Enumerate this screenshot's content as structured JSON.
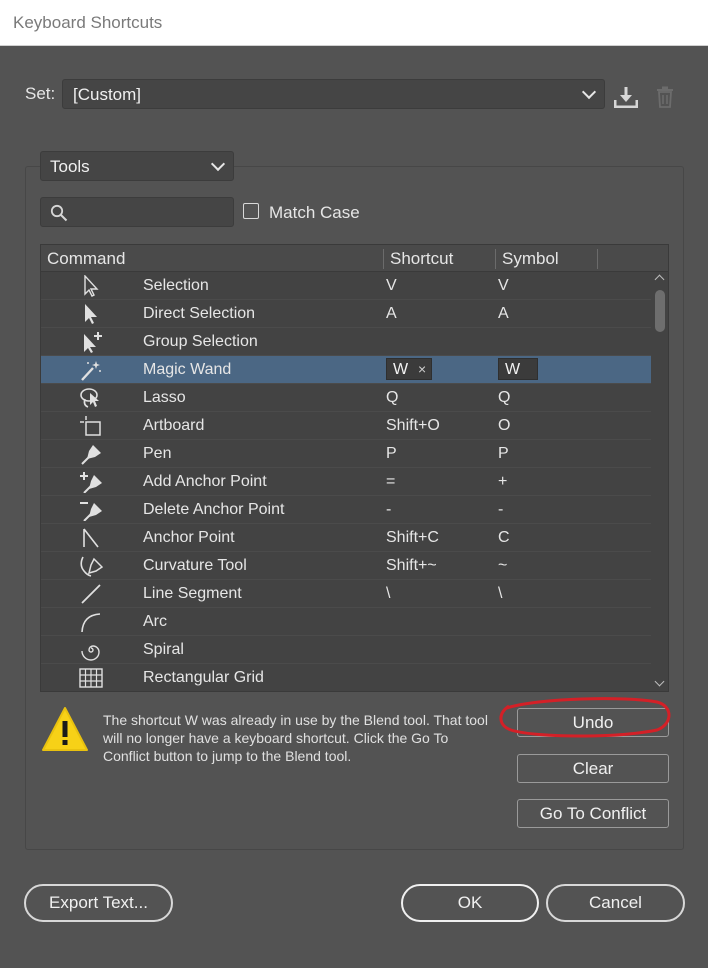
{
  "window": {
    "title": "Keyboard Shortcuts"
  },
  "set": {
    "label": "Set:",
    "value": "[Custom]"
  },
  "category": {
    "value": "Tools"
  },
  "search": {
    "placeholder": "",
    "value": ""
  },
  "match_case": {
    "label": "Match Case",
    "checked": false
  },
  "table": {
    "headers": {
      "command": "Command",
      "shortcut": "Shortcut",
      "symbol": "Symbol"
    },
    "rows": [
      {
        "icon": "selection-arrow-icon",
        "command": "Selection",
        "shortcut": "V",
        "symbol": "V"
      },
      {
        "icon": "direct-selection-arrow-icon",
        "command": "Direct Selection",
        "shortcut": "A",
        "symbol": "A"
      },
      {
        "icon": "group-selection-icon",
        "command": "Group Selection",
        "shortcut": "",
        "symbol": ""
      },
      {
        "icon": "magic-wand-icon",
        "command": "Magic Wand",
        "shortcut": "W",
        "symbol": "W",
        "selected": true
      },
      {
        "icon": "lasso-icon",
        "command": "Lasso",
        "shortcut": "Q",
        "symbol": "Q"
      },
      {
        "icon": "artboard-icon",
        "command": "Artboard",
        "shortcut": "Shift+O",
        "symbol": "O"
      },
      {
        "icon": "pen-icon",
        "command": "Pen",
        "shortcut": "P",
        "symbol": "P"
      },
      {
        "icon": "add-anchor-point-icon",
        "command": "Add Anchor Point",
        "shortcut": "=",
        "symbol": "+"
      },
      {
        "icon": "delete-anchor-point-icon",
        "command": "Delete Anchor Point",
        "shortcut": "-",
        "symbol": "-"
      },
      {
        "icon": "anchor-point-icon",
        "command": "Anchor Point",
        "shortcut": "Shift+C",
        "symbol": "C"
      },
      {
        "icon": "curvature-tool-icon",
        "command": "Curvature Tool",
        "shortcut": "Shift+~",
        "symbol": "~"
      },
      {
        "icon": "line-segment-icon",
        "command": "Line Segment",
        "shortcut": "\\",
        "symbol": "\\"
      },
      {
        "icon": "arc-icon",
        "command": "Arc",
        "shortcut": "",
        "symbol": ""
      },
      {
        "icon": "spiral-icon",
        "command": "Spiral",
        "shortcut": "",
        "symbol": ""
      },
      {
        "icon": "rectangular-grid-icon",
        "command": "Rectangular Grid",
        "shortcut": "",
        "symbol": ""
      }
    ]
  },
  "conflict": {
    "icon": "warning-icon",
    "message": "The shortcut W was already in use by the Blend tool. That tool will no longer have a keyboard shortcut. Click the Go To Conflict button to jump to the Blend tool."
  },
  "buttons": {
    "undo": "Undo",
    "clear": "Clear",
    "go_to_conflict": "Go To Conflict",
    "export_text": "Export Text...",
    "ok": "OK",
    "cancel": "Cancel"
  },
  "colors": {
    "panel_bg": "#535353",
    "selected_row": "#4b6784",
    "annotation_red": "#d42027",
    "warning_yellow": "#f7d117"
  }
}
